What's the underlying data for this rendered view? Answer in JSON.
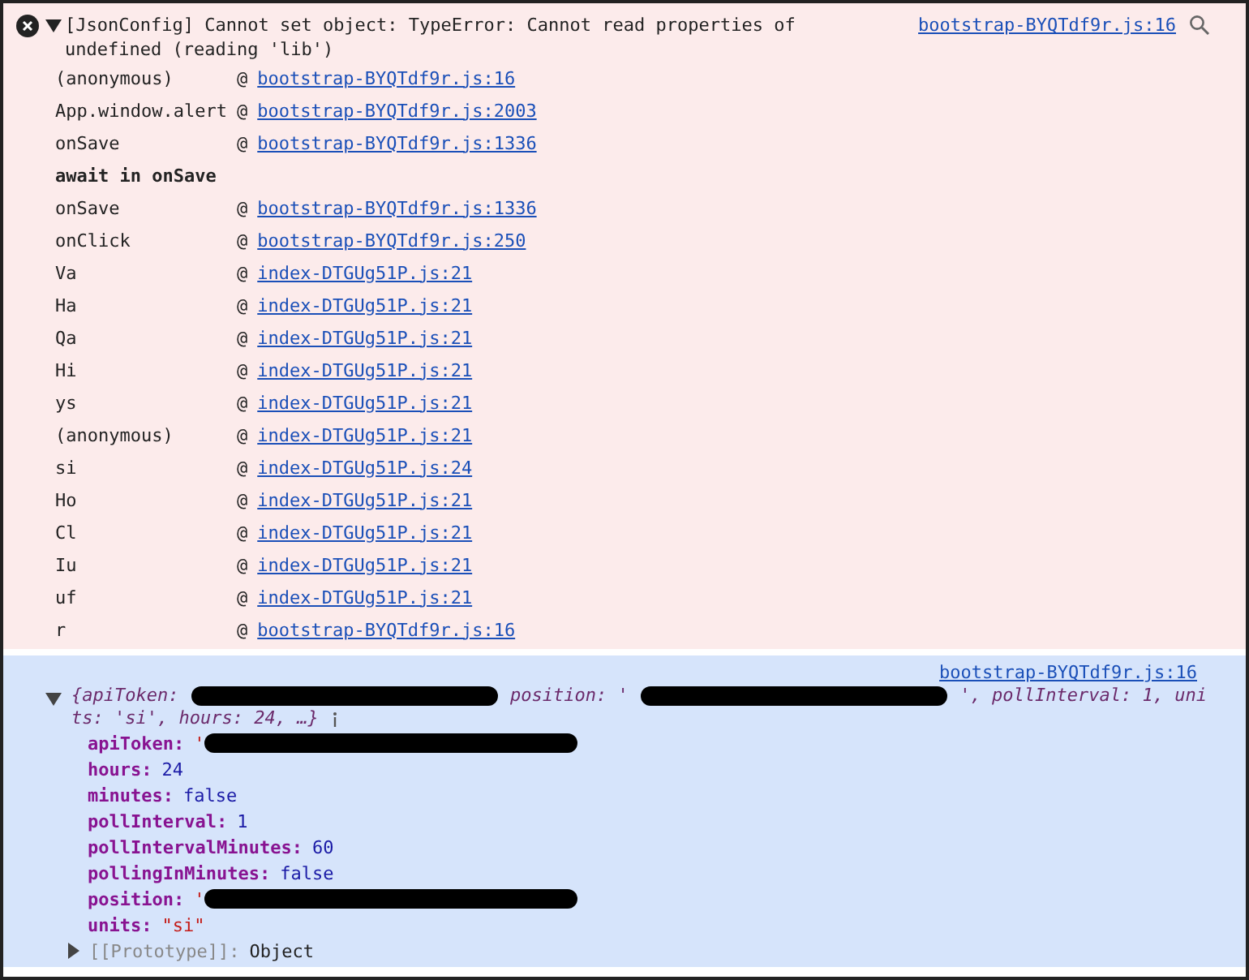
{
  "error": {
    "expanded": true,
    "message": "[JsonConfig] Cannot set object: TypeError: Cannot read properties of undefined (reading 'lib')",
    "source": "bootstrap-BYQTdf9r.js:16",
    "stack": [
      {
        "kind": "frame",
        "fn": "(anonymous)",
        "at": "@",
        "link": "bootstrap-BYQTdf9r.js:16"
      },
      {
        "kind": "frame",
        "fn": "App.window.alert",
        "at": "@",
        "link": "bootstrap-BYQTdf9r.js:2003"
      },
      {
        "kind": "frame",
        "fn": "onSave",
        "at": "@",
        "link": "bootstrap-BYQTdf9r.js:1336"
      },
      {
        "kind": "async",
        "label": "await in onSave"
      },
      {
        "kind": "frame",
        "fn": "onSave",
        "at": "@",
        "link": "bootstrap-BYQTdf9r.js:1336"
      },
      {
        "kind": "frame",
        "fn": "onClick",
        "at": "@",
        "link": "bootstrap-BYQTdf9r.js:250"
      },
      {
        "kind": "frame",
        "fn": "Va",
        "at": "@",
        "link": "index-DTGUg51P.js:21"
      },
      {
        "kind": "frame",
        "fn": "Ha",
        "at": "@",
        "link": "index-DTGUg51P.js:21"
      },
      {
        "kind": "frame",
        "fn": "Qa",
        "at": "@",
        "link": "index-DTGUg51P.js:21"
      },
      {
        "kind": "frame",
        "fn": "Hi",
        "at": "@",
        "link": "index-DTGUg51P.js:21"
      },
      {
        "kind": "frame",
        "fn": "ys",
        "at": "@",
        "link": "index-DTGUg51P.js:21"
      },
      {
        "kind": "frame",
        "fn": "(anonymous)",
        "at": "@",
        "link": "index-DTGUg51P.js:21"
      },
      {
        "kind": "frame",
        "fn": "si",
        "at": "@",
        "link": "index-DTGUg51P.js:24"
      },
      {
        "kind": "frame",
        "fn": "Ho",
        "at": "@",
        "link": "index-DTGUg51P.js:21"
      },
      {
        "kind": "frame",
        "fn": "Cl",
        "at": "@",
        "link": "index-DTGUg51P.js:21"
      },
      {
        "kind": "frame",
        "fn": "Iu",
        "at": "@",
        "link": "index-DTGUg51P.js:21"
      },
      {
        "kind": "frame",
        "fn": "uf",
        "at": "@",
        "link": "index-DTGUg51P.js:21"
      },
      {
        "kind": "frame",
        "fn": "r",
        "at": "@",
        "link": "bootstrap-BYQTdf9r.js:16"
      }
    ]
  },
  "object": {
    "source": "bootstrap-BYQTdf9r.js:16",
    "expanded": true,
    "preview": [
      [
        {
          "kind": "text",
          "text": "{apiToken:"
        },
        {
          "kind": "redacted"
        },
        {
          "kind": "text",
          "text": "position: '"
        },
        {
          "kind": "redacted"
        },
        {
          "kind": "text",
          "text": "', pollInterval: 1, uni"
        }
      ],
      [
        {
          "kind": "text",
          "text": "ts: 'si', hours: 24, …}"
        }
      ]
    ],
    "properties": [
      {
        "key": "apiToken:",
        "kind": "redacted",
        "value": "'"
      },
      {
        "key": "hours:",
        "kind": "number",
        "value": "24"
      },
      {
        "key": "minutes:",
        "kind": "boolean",
        "value": "false"
      },
      {
        "key": "pollInterval:",
        "kind": "number",
        "value": "1"
      },
      {
        "key": "pollIntervalMinutes:",
        "kind": "number",
        "value": "60"
      },
      {
        "key": "pollingInMinutes:",
        "kind": "boolean",
        "value": "false"
      },
      {
        "key": "position:",
        "kind": "redacted",
        "value": "'"
      },
      {
        "key": "units:",
        "kind": "string",
        "value": "\"si\""
      }
    ],
    "prototype": {
      "key": "[[Prototype]]:",
      "value": "Object",
      "expanded": false
    }
  }
}
